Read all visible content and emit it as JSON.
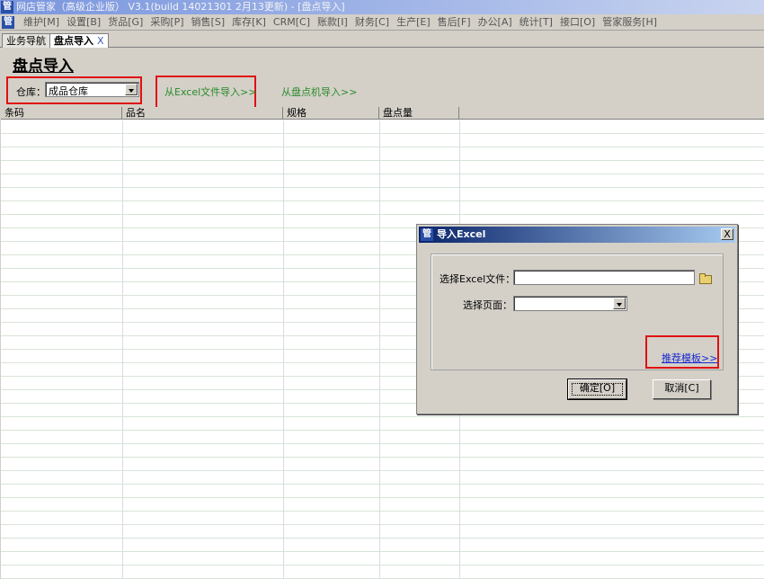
{
  "window": {
    "icon": "管",
    "title": "网店管家（高级企业版） V3.1(build 14021301 2月13更新) - [盘点导入]"
  },
  "menu": [
    "维护[M]",
    "设置[B]",
    "货品[G]",
    "采购[P]",
    "销售[S]",
    "库存[K]",
    "CRM[C]",
    "账款[I]",
    "财务[C]",
    "生产[E]",
    "售后[F]",
    "办公[A]",
    "统计[T]",
    "接口[O]",
    "管家服务[H]"
  ],
  "tabs": {
    "nav": "业务导航",
    "current": "盘点导入",
    "close": "X"
  },
  "page": {
    "title": "盘点导入",
    "warehouse_label": "仓库：",
    "warehouse_value": "成品仓库",
    "import_excel_link": "从Excel文件导入>>",
    "import_device_link": "从盘点机导入>>"
  },
  "grid": {
    "columns": [
      "条码",
      "品名",
      "规格",
      "盘点量"
    ]
  },
  "dialog": {
    "icon": "管",
    "title": "导入Excel",
    "close": "X",
    "file_label": "选择Excel文件：",
    "file_value": "",
    "sheet_label": "选择页面：",
    "sheet_value": "",
    "template_link": "推荐模板>>",
    "ok_button": "确定[O]",
    "cancel_button": "取消[C]"
  },
  "colors": {
    "highlight_box": "#e01010",
    "link_green": "#2a8a2a",
    "link_blue": "#1a2ad0"
  },
  "icons": [
    "app-icon",
    "folder-open-icon",
    "dropdown-arrow-icon",
    "close-icon"
  ]
}
